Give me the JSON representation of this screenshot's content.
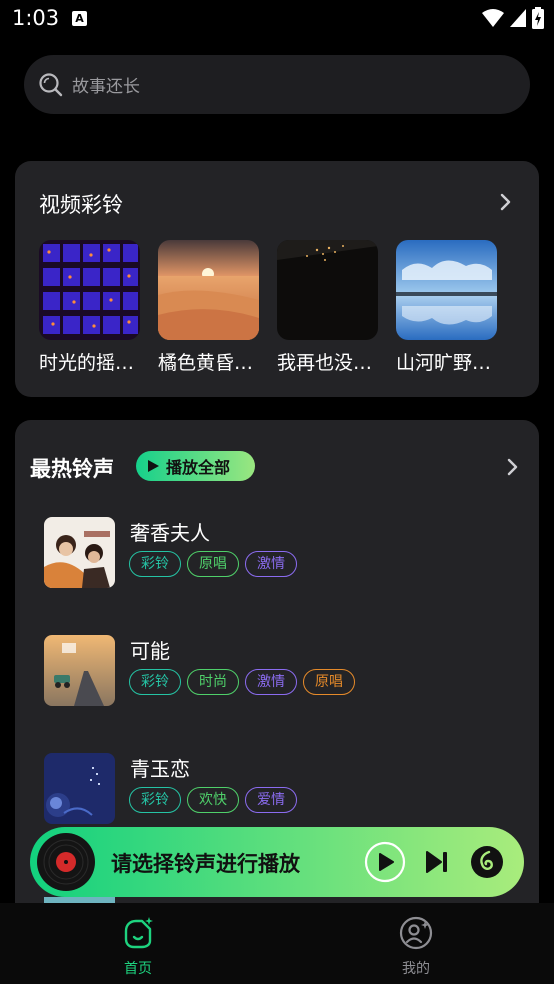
{
  "status": {
    "time": "1:03",
    "a_badge": "A"
  },
  "search": {
    "placeholder": "故事还长"
  },
  "video_section": {
    "title": "视频彩铃",
    "items": [
      {
        "label": "时光的摇…"
      },
      {
        "label": "橘色黄昏…"
      },
      {
        "label": "我再也没…"
      },
      {
        "label": "山河旷野…"
      }
    ]
  },
  "hot_section": {
    "title": "最热铃声",
    "play_all": "播放全部",
    "songs": [
      {
        "name": "奢香夫人",
        "tags": [
          "彩铃",
          "原唱",
          "激情"
        ]
      },
      {
        "name": "可能",
        "tags": [
          "彩铃",
          "时尚",
          "激情",
          "原唱"
        ]
      },
      {
        "name": "青玉恋",
        "tags": [
          "彩铃",
          "欢快",
          "爱情"
        ]
      }
    ]
  },
  "player": {
    "label": "请选择铃声进行播放"
  },
  "tabs": [
    {
      "label": "首页",
      "active": true
    },
    {
      "label": "我的",
      "active": false
    }
  ],
  "colors": {
    "accent_green": "#1ed37f",
    "tag_teal": "#25c3a4",
    "tag_green": "#4fd06a",
    "tag_purple": "#8b6cf0",
    "tag_orange": "#e58a2a"
  }
}
